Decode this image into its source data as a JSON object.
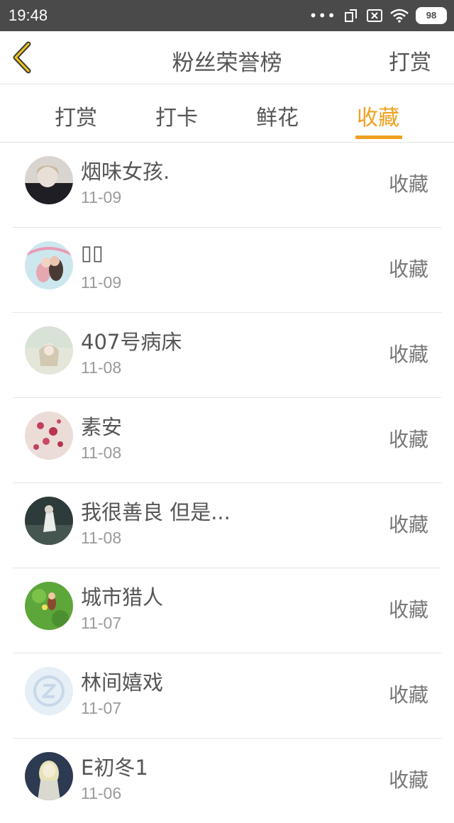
{
  "status_bar": {
    "time": "19:48",
    "dots": "•••",
    "battery": "98"
  },
  "header": {
    "title": "粉丝荣誉榜",
    "action_label": "打赏",
    "accent_color": "#f0a01f"
  },
  "tabs": [
    {
      "label": "打赏",
      "active": false
    },
    {
      "label": "打卡",
      "active": false
    },
    {
      "label": "鲜花",
      "active": false
    },
    {
      "label": "收藏",
      "active": true
    }
  ],
  "list": [
    {
      "name": "烟味女孩.",
      "date": "11-09",
      "action": "收藏"
    },
    {
      "name": "▯▯",
      "date": "11-09",
      "action": "收藏"
    },
    {
      "name": "407号病床",
      "date": "11-08",
      "action": "收藏"
    },
    {
      "name": "素安",
      "date": "11-08",
      "action": "收藏"
    },
    {
      "name": "我很善良 但是...",
      "date": "11-08",
      "action": "收藏"
    },
    {
      "name": "城市猎人",
      "date": "11-07",
      "action": "收藏"
    },
    {
      "name": "林间嬉戏",
      "date": "11-07",
      "action": "收藏"
    },
    {
      "name": "E初冬1",
      "date": "11-06",
      "action": "收藏"
    }
  ]
}
